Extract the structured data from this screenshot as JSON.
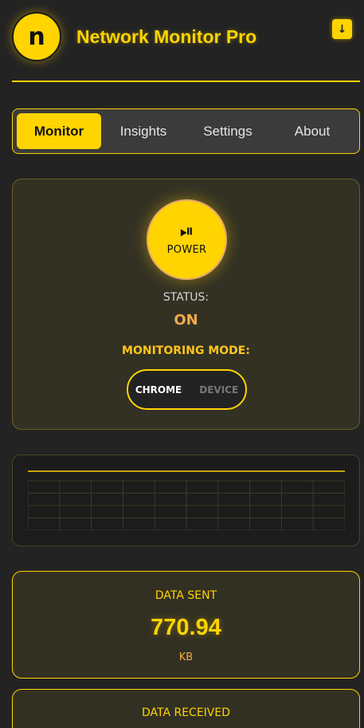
{
  "header": {
    "logo_letter": "n",
    "title": "Network Monitor Pro",
    "download_icon": "↓"
  },
  "tabs": [
    {
      "label": "Monitor",
      "active": true
    },
    {
      "label": "Insights",
      "active": false
    },
    {
      "label": "Settings",
      "active": false
    },
    {
      "label": "About",
      "active": false
    }
  ],
  "power": {
    "glyph": "⏯",
    "label": "POWER",
    "status_label": "STATUS:",
    "status_value": "ON",
    "mode_label": "MONITORING MODE:",
    "modes": [
      "CHROME",
      "DEVICE"
    ],
    "selected_mode": "CHROME"
  },
  "graph": {
    "line_level": 1.0,
    "grid_cols": 10,
    "grid_rows": 4
  },
  "stats": {
    "sent": {
      "title": "DATA SENT",
      "value": "770.94",
      "unit": "KB"
    },
    "received": {
      "title": "DATA RECEIVED"
    }
  },
  "colors": {
    "accent": "#ffd400",
    "status_on": "#f2a94a",
    "background": "#232323"
  }
}
